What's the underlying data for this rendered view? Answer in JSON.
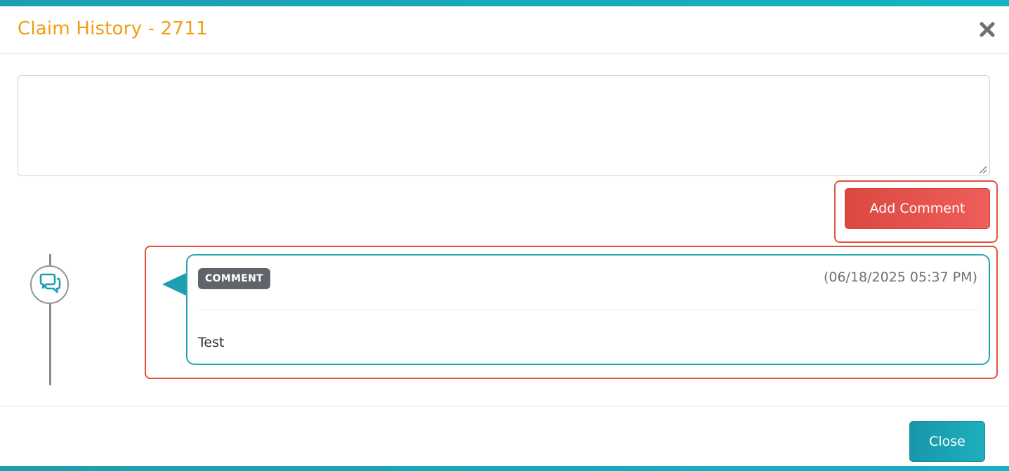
{
  "modal": {
    "title": "Claim History - 2711"
  },
  "comment_input": {
    "value": "",
    "placeholder": ""
  },
  "actions": {
    "add_comment_label": "Add Comment",
    "close_label": "Close"
  },
  "timeline": {
    "entries": [
      {
        "type_badge": "COMMENT",
        "timestamp": "(06/18/2025 05:37 PM)",
        "text": "Test",
        "icon": "comments-icon"
      }
    ]
  },
  "colors": {
    "title": "#f39c12",
    "accent": "#1c9fb0",
    "add_button": "#e04b46",
    "highlight": "#e0533e",
    "badge": "#5f646a"
  }
}
